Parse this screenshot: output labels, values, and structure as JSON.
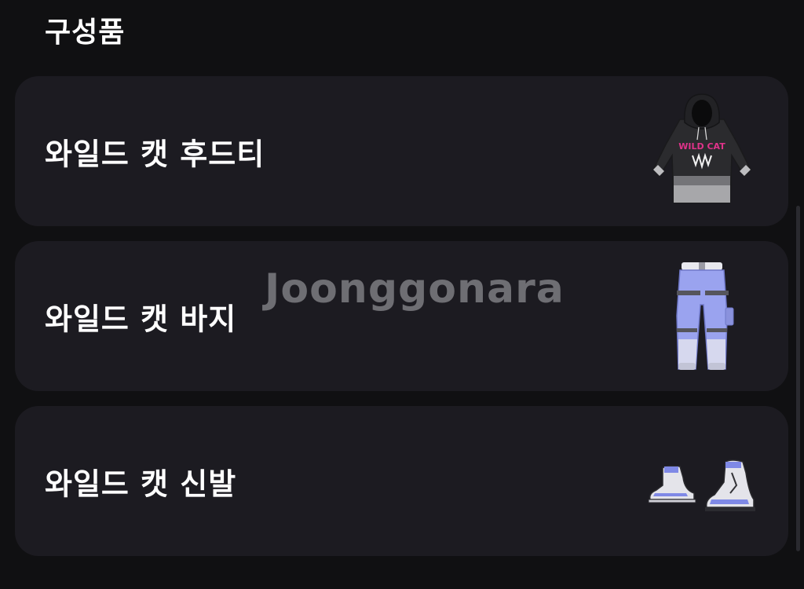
{
  "section": {
    "title": "구성품"
  },
  "items": [
    {
      "name": "와일드 캣 후드티",
      "icon": "hoodie-icon",
      "hood_text": "WILD CAT"
    },
    {
      "name": "와일드 캣 바지",
      "icon": "pants-icon"
    },
    {
      "name": "와일드 캣 신발",
      "icon": "sneakers-icon"
    }
  ],
  "watermark": {
    "text": "Joonggonara"
  },
  "colors": {
    "background": "#101012",
    "card": "#1c1b21",
    "text": "#ffffff",
    "pants_accent": "#9aa3ef",
    "hoodie_print": "#e0338a"
  }
}
